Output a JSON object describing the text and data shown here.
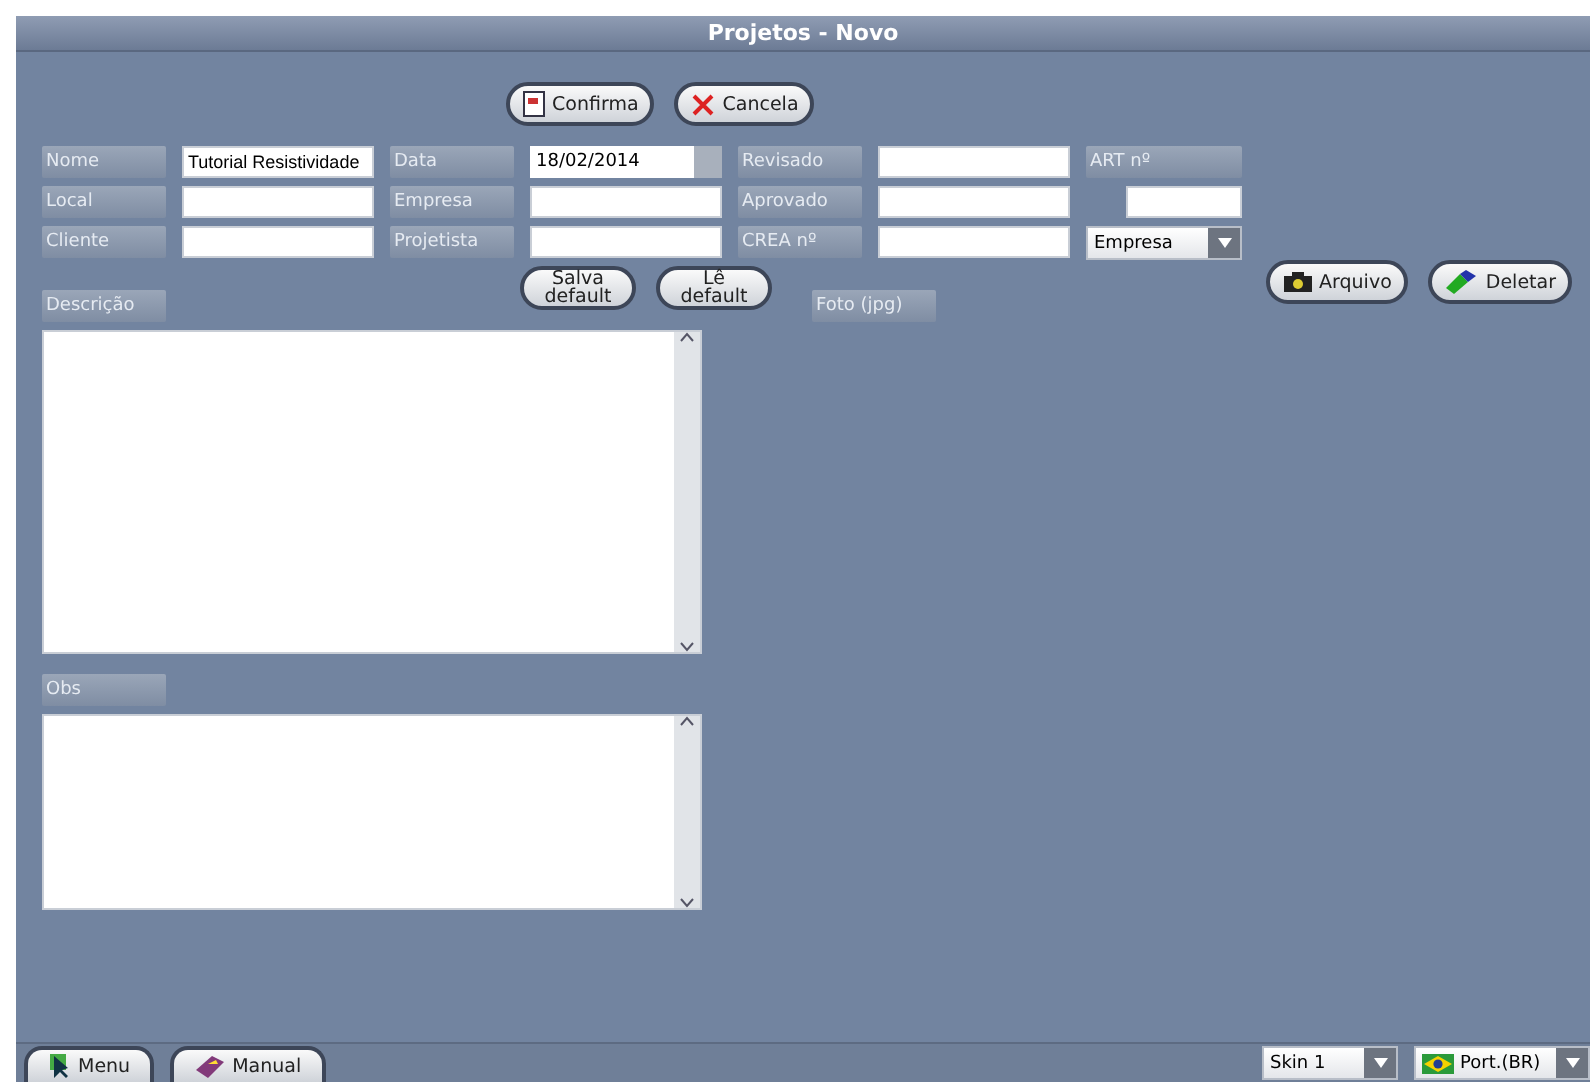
{
  "window": {
    "title": "Projetos - Novo"
  },
  "top_buttons": [
    {
      "label": "Confirma",
      "kind": "confirm"
    },
    {
      "label": "Cancela",
      "kind": "cancel"
    }
  ],
  "form_rows": [
    [
      {
        "kind": "label",
        "text": "Nome"
      },
      {
        "kind": "input",
        "value": "Tutorial Resistividade"
      },
      {
        "kind": "label",
        "text": "Data"
      },
      {
        "kind": "date",
        "value": "18/02/2014"
      },
      {
        "kind": "label",
        "text": "Revisado"
      },
      {
        "kind": "input"
      },
      {
        "kind": "label",
        "text": "ART nº"
      }
    ],
    [
      {
        "kind": "label",
        "text": "Local"
      },
      {
        "kind": "input"
      },
      {
        "kind": "label",
        "text": "Empresa"
      },
      {
        "kind": "input"
      },
      {
        "kind": "label",
        "text": "Aprovado"
      },
      {
        "kind": "input"
      },
      {
        "kind": "small-input"
      }
    ],
    [
      {
        "kind": "label",
        "text": "Cliente"
      },
      {
        "kind": "input"
      },
      {
        "kind": "label",
        "text": "Projetista"
      },
      {
        "kind": "input"
      },
      {
        "kind": "label",
        "text": "CREA nº"
      },
      {
        "kind": "input"
      },
      {
        "kind": "select",
        "value": "Empresa"
      }
    ]
  ],
  "default_buttons": [
    "Salva default",
    "Lê default"
  ],
  "description": {
    "label": "Descrição"
  },
  "photo": {
    "label": "Foto (jpg)",
    "buttons": [
      {
        "label": "Arquivo",
        "kind": "camera"
      },
      {
        "label": "Deletar",
        "kind": "eraser"
      }
    ]
  },
  "obs": {
    "label": "Obs"
  },
  "bottom_bar": {
    "buttons": [
      {
        "label": "Menu",
        "kind": "cursor"
      },
      {
        "label": "Manual",
        "kind": "book"
      }
    ],
    "skin": "Skin 1",
    "language": "Port.(BR)"
  }
}
